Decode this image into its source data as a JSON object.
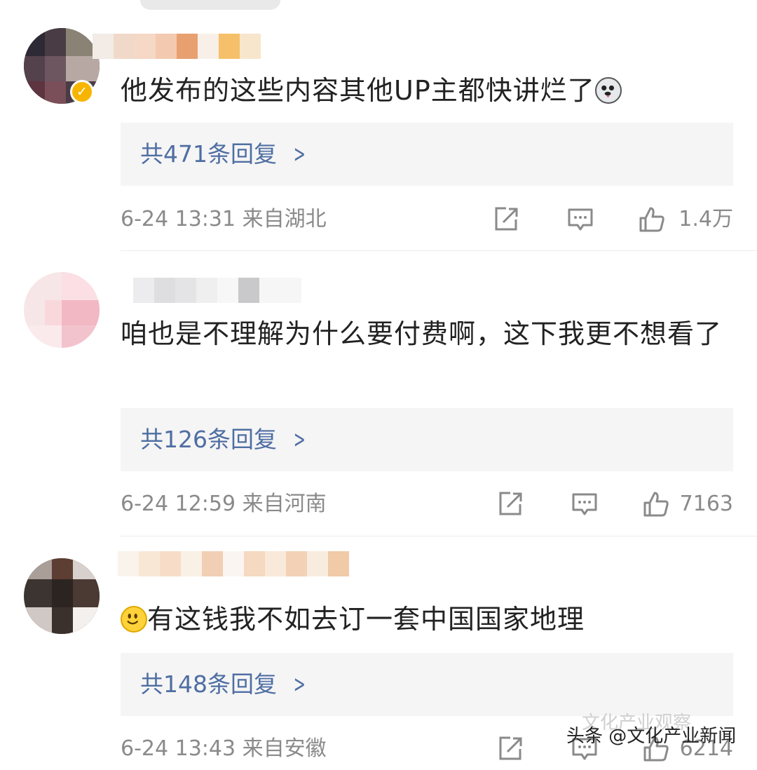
{
  "comments": [
    {
      "text": "他发布的这些内容其他UP主都快讲烂了",
      "emoji_after": "husky-emoji",
      "verified": true,
      "reply_label": "共471条回复",
      "time": "6-24 13:31",
      "location": "来自湖北",
      "likes": "1.4万"
    },
    {
      "text": "咱也是不理解为什么要付费啊，这下我更不想看了",
      "reply_label": "共126条回复",
      "time": "6-24 12:59",
      "location": "来自河南",
      "likes": "7163"
    },
    {
      "text": "有这钱我不如去订一套中国国家地理",
      "emoji_before": "smile-emoji",
      "reply_label": "共148条回复",
      "time": "6-24 13:43",
      "location": "来自安徽",
      "likes": "6214"
    }
  ],
  "watermark": "头条 @文化产业新闻",
  "watermark_faint": "文化产业观察",
  "colors": {
    "link": "#4f6ea3",
    "meta_text": "#8a8a8a",
    "reply_bg": "#f5f5f5",
    "verified_badge": "#f7b500"
  }
}
